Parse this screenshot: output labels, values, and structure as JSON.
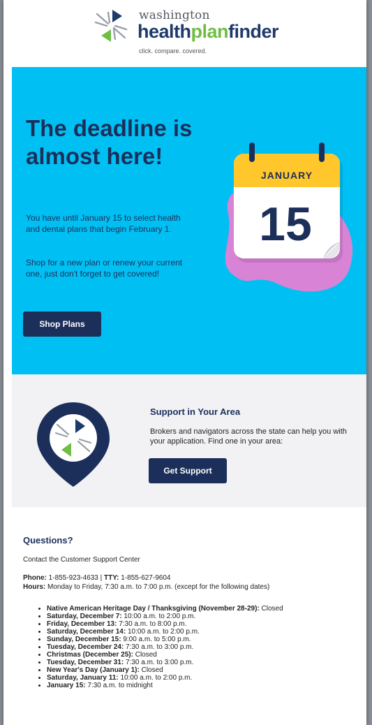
{
  "header": {
    "logo_small": "washington",
    "logo_part1": "health",
    "logo_part2": "plan",
    "logo_part3": "finder",
    "tagline": "click. compare. covered."
  },
  "hero": {
    "title": "The deadline is almost here!",
    "paragraph1": "You have until January 15 to select health and dental plans that begin February 1.",
    "paragraph2": "Shop for a new plan or renew your current one, just don't forget to get covered!",
    "button": "Shop Plans",
    "calendar_month": "JANUARY",
    "calendar_day": "15"
  },
  "support": {
    "title": "Support in Your Area",
    "text": "Brokers and navigators across the state can help you with your application. Find one in your area:",
    "button": "Get Support"
  },
  "questions": {
    "title": "Questions?",
    "contact": "Contact the Customer Support Center",
    "phone_label": "Phone:",
    "phone": "1-855-923-4633",
    "separator": "|",
    "tty_label": "TTY:",
    "tty": "1-855-627-9604",
    "hours_label": "Hours:",
    "hours": "Monday to Friday, 7:30 a.m. to 7:00 p.m. (except for the following dates)",
    "dates": [
      {
        "label": "Native American Heritage Day / Thanksgiving (November 28-29):",
        "value": "Closed"
      },
      {
        "label": "Saturday, December 7:",
        "value": "10:00 a.m. to 2:00 p.m."
      },
      {
        "label": "Friday, December 13:",
        "value": "7:30 a.m. to 8:00 p.m."
      },
      {
        "label": "Saturday, December 14:",
        "value": "10:00 a.m. to 2:00 p.m."
      },
      {
        "label": "Sunday, December 15:",
        "value": "9:00 a.m. to 5:00 p.m."
      },
      {
        "label": "Tuesday, December 24:",
        "value": "7:30 a.m. to 3:00 p.m."
      },
      {
        "label": "Christmas (December 25):",
        "value": "Closed"
      },
      {
        "label": "Tuesday, December 31:",
        "value": "7:30 a.m. to 3:00 p.m."
      },
      {
        "label": "New Year's Day (January 1):",
        "value": "Closed"
      },
      {
        "label": "Saturday, January 11:",
        "value": "10:00 a.m. to 2:00 p.m."
      },
      {
        "label": "January 15:",
        "value": "7:30 a.m. to midnight"
      }
    ]
  },
  "colors": {
    "navy": "#1b2f5a",
    "cyan": "#00c0f3",
    "green": "#6fbe44",
    "calendar_yellow": "#ffc72c",
    "blob_pink": "#d883d6",
    "support_bg": "#f2f2f4"
  },
  "icons": [
    "logo-mark-icon",
    "calendar-icon",
    "location-pin-icon"
  ]
}
